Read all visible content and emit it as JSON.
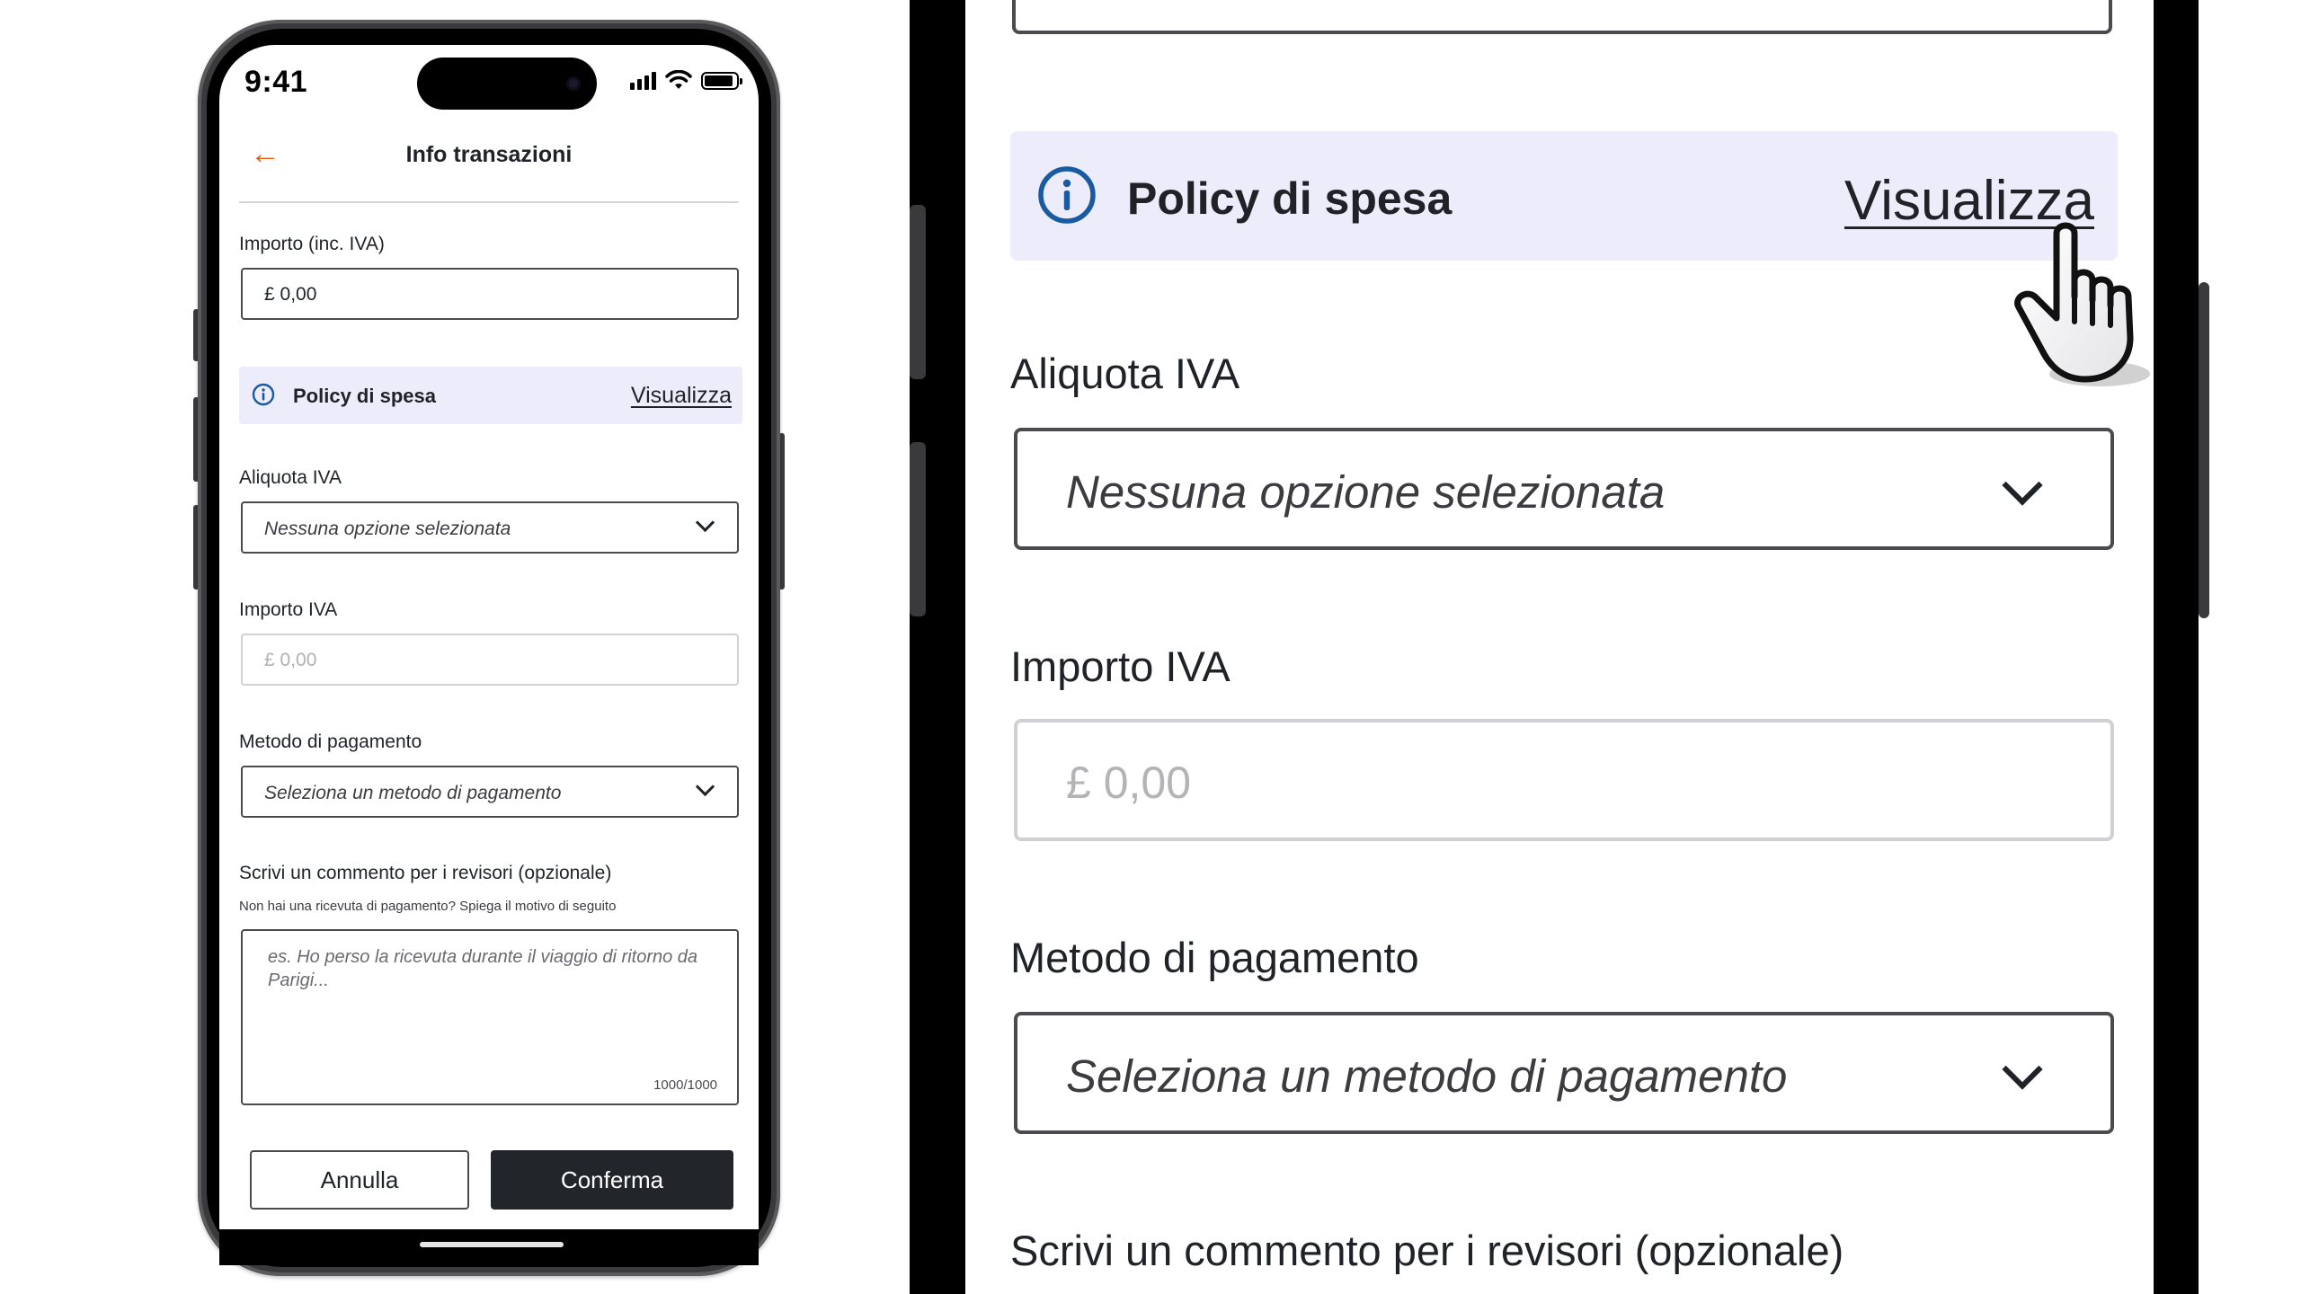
{
  "status_bar": {
    "time": "9:41"
  },
  "nav": {
    "title": "Info transazioni"
  },
  "form": {
    "amount": {
      "label": "Importo (inc. IVA)",
      "value": "£ 0,00"
    },
    "policy": {
      "title": "Policy di spesa",
      "link": "Visualizza"
    },
    "vat_rate": {
      "label": "Aliquota IVA",
      "placeholder": "Nessuna opzione selezionata"
    },
    "vat_amount": {
      "label": "Importo IVA",
      "value": "£ 0,00"
    },
    "payment_method": {
      "label": "Metodo di pagamento",
      "placeholder": "Seleziona un metodo di pagamento"
    },
    "comment": {
      "label": "Scrivi un commento per i revisori (opzionale)",
      "help": "Non hai una ricevuta di pagamento? Spiega il motivo di seguito",
      "placeholder": "es. Ho perso la ricevuta durante il viaggio di ritorno da Parigi...",
      "counter": "1000/1000"
    }
  },
  "actions": {
    "cancel": "Annulla",
    "confirm": "Conferma"
  },
  "colors": {
    "accent": "#e85d0f",
    "info_blue": "#1a5aa0",
    "policy_bg": "#ececfa",
    "primary_button": "#22262b"
  },
  "icons": {
    "back": "arrow-left-icon",
    "info": "info-circle-icon",
    "chevron": "chevron-down-icon",
    "cursor": "hand-pointer-icon"
  }
}
